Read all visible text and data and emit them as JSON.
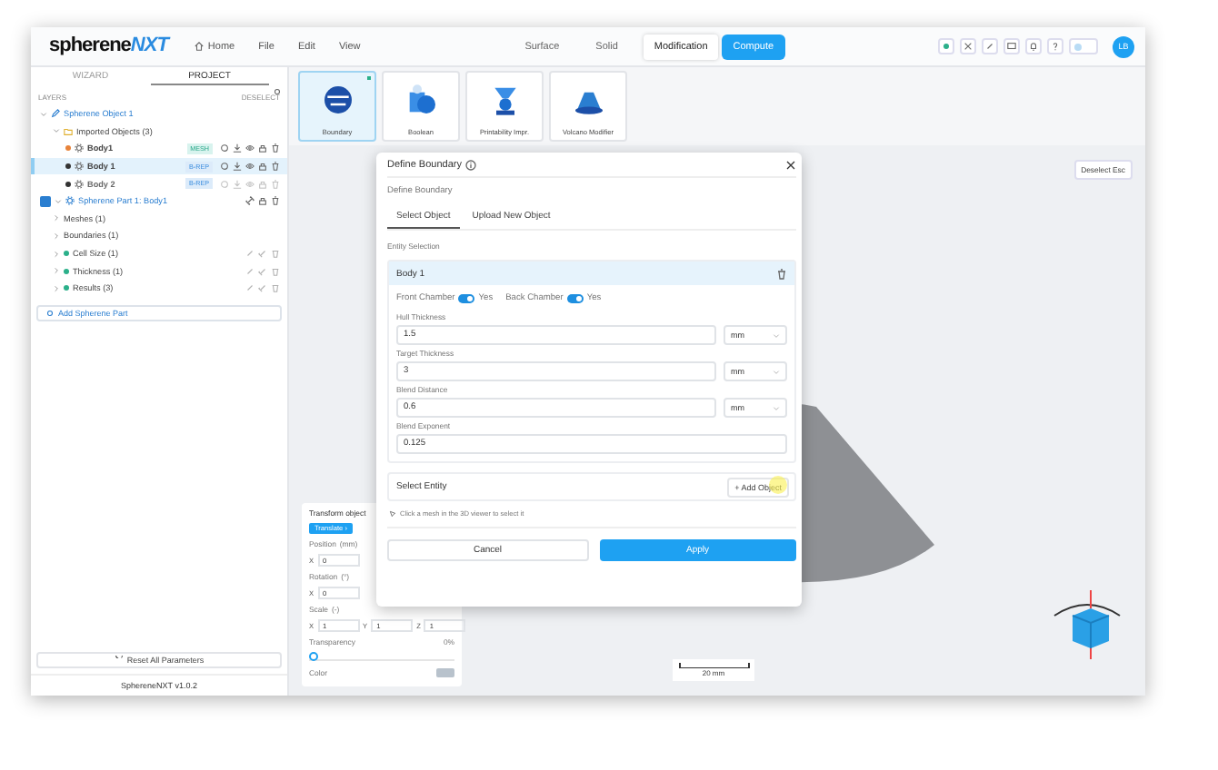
{
  "logo": {
    "main": "spherene",
    "accent": "NXT"
  },
  "menu": [
    {
      "label": "Home",
      "kind": "home"
    },
    {
      "label": "File",
      "kind": "plain"
    },
    {
      "label": "Edit",
      "kind": "plain"
    },
    {
      "label": "View",
      "kind": "plain"
    }
  ],
  "mode_tabs": [
    {
      "label": "Surface",
      "selected": false
    },
    {
      "label": "Solid",
      "selected": false
    },
    {
      "label": "Modification",
      "selected": true
    }
  ],
  "compute_button": "Compute",
  "avatar": "LB",
  "theme_toggle": {
    "on": false
  },
  "sidebar": {
    "tabs": [
      {
        "label": "WIZARD",
        "selected": false
      },
      {
        "label": "PROJECT",
        "selected": true
      }
    ],
    "layers_label": "LAYERS",
    "deselect": "DESELECT",
    "tree": [
      {
        "label": "Spherene Object 1",
        "kind": "object",
        "expanded": true,
        "children": [
          {
            "label": "Imported Objects (3)",
            "kind": "folder",
            "expanded": true,
            "children": [
              {
                "label": "Body1",
                "kind": "body",
                "badge": "MESH",
                "color": "#e8833a",
                "selected": false,
                "disabled": false
              },
              {
                "label": "Body 1",
                "kind": "body",
                "badge": "B-REP",
                "color": "#333333",
                "selected": true,
                "disabled": false
              },
              {
                "label": "Body 2",
                "kind": "body",
                "badge": "B-REP",
                "color": "#333333",
                "selected": false,
                "disabled": true
              }
            ]
          }
        ]
      },
      {
        "label": "Spherene Part 1: Body1",
        "kind": "part",
        "expanded": true,
        "checked": true,
        "children": [
          {
            "label": "Meshes (1)",
            "kind": "group",
            "expanded": false
          },
          {
            "label": "Boundaries (1)",
            "kind": "group",
            "expanded": false
          },
          {
            "label": "Cell Size (1)",
            "kind": "param",
            "expanded": false,
            "color": "#2bb08a"
          },
          {
            "label": "Thickness (1)",
            "kind": "param",
            "expanded": false,
            "color": "#2bb08a"
          },
          {
            "label": "Results (3)",
            "kind": "param",
            "expanded": false,
            "color": "#2bb08a"
          }
        ]
      }
    ],
    "add_part": "Add Spherene Part",
    "reset": "Reset All Parameters",
    "version": "SphereneNXT v1.0.2"
  },
  "tools": [
    {
      "label": "Boundary",
      "kind": "boundary",
      "selected": true
    },
    {
      "label": "Boolean",
      "kind": "boolean",
      "selected": false
    },
    {
      "label": "Printability Impr.",
      "kind": "printability",
      "selected": false
    },
    {
      "label": "Volcano Modifier",
      "kind": "volcano",
      "selected": false
    }
  ],
  "deselect_button": "Deselect Esc",
  "dialog": {
    "title": "Define Boundary",
    "subtitle": "Define Boundary",
    "tabs": [
      {
        "label": "Select Object",
        "selected": true
      },
      {
        "label": "Upload New Object",
        "selected": false
      }
    ],
    "section": "Entity Selection",
    "card_title": "Body 1",
    "toggles": [
      {
        "label": "Front Chamber",
        "on": true,
        "value": "Yes"
      },
      {
        "label": "Back Chamber",
        "on": true,
        "value": "Yes"
      }
    ],
    "fields": [
      {
        "label": "Hull Thickness",
        "value": "1.5",
        "unit": "mm"
      },
      {
        "label": "Target Thickness",
        "value": "3",
        "unit": "mm"
      },
      {
        "label": "Blend Distance",
        "value": "0.6",
        "unit": "mm"
      },
      {
        "label": "Blend Exponent",
        "value": "0.125"
      }
    ],
    "select_entity": "Select Entity",
    "add_object": "+ Add Object",
    "hint": "Click a mesh in the 3D viewer to select it",
    "cancel": "Cancel",
    "apply": "Apply"
  },
  "transform": {
    "title": "Transform object",
    "mode": "Translate ›",
    "position": "Position",
    "position_unit": "(mm)",
    "rotation": "Rotation",
    "rotation_unit": "(°)",
    "scale": "Scale",
    "scale_unit": "(-)",
    "position_fields": [
      {
        "axis": "X",
        "value": "0"
      }
    ],
    "rotation_fields": [
      {
        "axis": "X",
        "value": "0"
      }
    ],
    "scale_fields": [
      {
        "axis": "X",
        "value": "1"
      },
      {
        "axis": "Y",
        "value": "1"
      },
      {
        "axis": "Z",
        "value": "1"
      }
    ],
    "transparency": "Transparency",
    "transparency_value": "0%",
    "level": 0,
    "color_label": "Color",
    "color": "#b8c2cc"
  },
  "scale_bar": "20 mm"
}
